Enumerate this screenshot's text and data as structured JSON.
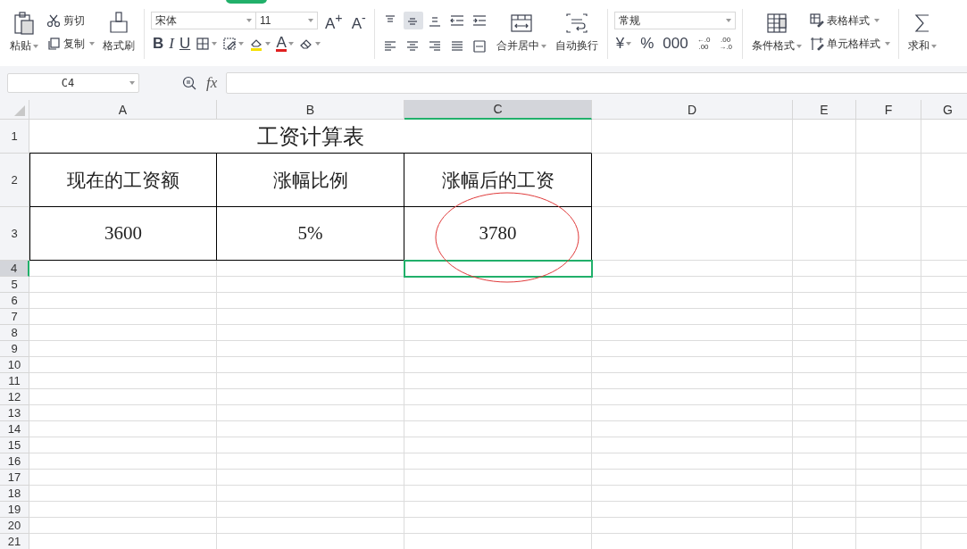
{
  "ribbon": {
    "clipboard": {
      "paste": {
        "label": "粘贴",
        "dropdown": true
      },
      "cut": {
        "label": "剪切"
      },
      "copy": {
        "label": "复制",
        "dropdown": true
      },
      "brush": {
        "label": "格式刷"
      }
    },
    "font": {
      "family": "宋体",
      "size": "11",
      "grow": "A$^{+}$",
      "shrink": "A$^{-}$",
      "buttons": [
        {
          "kind": "bold",
          "label": "B",
          "dropdown": false
        },
        {
          "kind": "italic",
          "label": "I",
          "dropdown": false
        },
        {
          "kind": "underline",
          "label": "U",
          "dropdown": false
        },
        {
          "kind": "borders",
          "dropdown": true
        },
        {
          "kind": "fill-pattern",
          "dropdown": true
        },
        {
          "kind": "fill-color",
          "color": "#f5e000",
          "dropdown": true
        },
        {
          "kind": "font-color",
          "label": "A",
          "color": "#e02020",
          "dropdown": true
        },
        {
          "kind": "eraser",
          "dropdown": true
        }
      ]
    },
    "align": {
      "buttons": [
        {
          "kind": "top",
          "selected": false
        },
        {
          "kind": "middle",
          "selected": true
        },
        {
          "kind": "bottom",
          "selected": false
        },
        {
          "kind": "outdent",
          "selected": false
        },
        {
          "kind": "indent",
          "selected": false
        },
        {
          "kind": "left",
          "selected": false
        },
        {
          "kind": "center",
          "selected": false
        },
        {
          "kind": "right",
          "selected": false
        },
        {
          "kind": "justify",
          "selected": false
        },
        {
          "kind": "distributed",
          "selected": false
        }
      ],
      "merge": {
        "label": "合并居中",
        "dropdown": true
      },
      "wrap": {
        "label": "自动换行"
      }
    },
    "number": {
      "format": "常规",
      "buttons": [
        {
          "label": "¥",
          "dropdown": true
        },
        {
          "label": "%",
          "dropdown": false
        },
        {
          "label": "000",
          "dropdown": false
        },
        {
          "label": "←.0\n.00",
          "dropdown": false
        },
        {
          "label": ".00\n→.0",
          "dropdown": false
        }
      ]
    },
    "styles": {
      "conditional": {
        "label": "条件格式",
        "dropdown": true
      },
      "table_style": {
        "label": "表格样式",
        "dropdown": true
      },
      "cell_style": {
        "label": "单元格样式",
        "dropdown": true
      }
    },
    "sum": {
      "label": "求和",
      "dropdown": true
    }
  },
  "name_box": "C4",
  "formula_label": "fx",
  "columns": [
    {
      "label": "A",
      "selected": false
    },
    {
      "label": "B",
      "selected": false
    },
    {
      "label": "C",
      "selected": true
    },
    {
      "label": "D",
      "selected": false
    },
    {
      "label": "E",
      "selected": false
    },
    {
      "label": "F",
      "selected": false
    },
    {
      "label": "G",
      "selected": false
    }
  ],
  "rows": [
    {
      "label": "1",
      "kind": "title",
      "selected": false,
      "cells": [
        {
          "text": "工资计算表"
        }
      ]
    },
    {
      "label": "2",
      "kind": "data",
      "selected": false,
      "cells": [
        {
          "text": "现在的工资额"
        },
        {
          "text": "涨幅比例"
        },
        {
          "text": "涨幅后的工资"
        }
      ]
    },
    {
      "label": "3",
      "kind": "data",
      "selected": false,
      "cells": [
        {
          "text": "3600"
        },
        {
          "text": "5%"
        },
        {
          "text": "3780",
          "annotation": {
            "kind": "ellipse",
            "color": "#e03a3a"
          }
        }
      ]
    },
    {
      "label": "4",
      "kind": "empty",
      "selected": true
    },
    {
      "label": "5",
      "kind": "empty",
      "selected": false
    },
    {
      "label": "6",
      "kind": "empty",
      "selected": false
    },
    {
      "label": "7",
      "kind": "empty",
      "selected": false
    },
    {
      "label": "8",
      "kind": "empty",
      "selected": false
    },
    {
      "label": "9",
      "kind": "empty",
      "selected": false
    },
    {
      "label": "10",
      "kind": "empty",
      "selected": false
    },
    {
      "label": "11",
      "kind": "empty",
      "selected": false
    },
    {
      "label": "12",
      "kind": "empty",
      "selected": false
    },
    {
      "label": "13",
      "kind": "empty",
      "selected": false
    },
    {
      "label": "14",
      "kind": "empty",
      "selected": false
    },
    {
      "label": "15",
      "kind": "empty",
      "selected": false
    },
    {
      "label": "16",
      "kind": "empty",
      "selected": false
    },
    {
      "label": "17",
      "kind": "empty",
      "selected": false
    },
    {
      "label": "18",
      "kind": "empty",
      "selected": false
    },
    {
      "label": "19",
      "kind": "empty",
      "selected": false
    },
    {
      "label": "20",
      "kind": "empty",
      "selected": false
    },
    {
      "label": "21",
      "kind": "empty",
      "selected": false
    }
  ]
}
